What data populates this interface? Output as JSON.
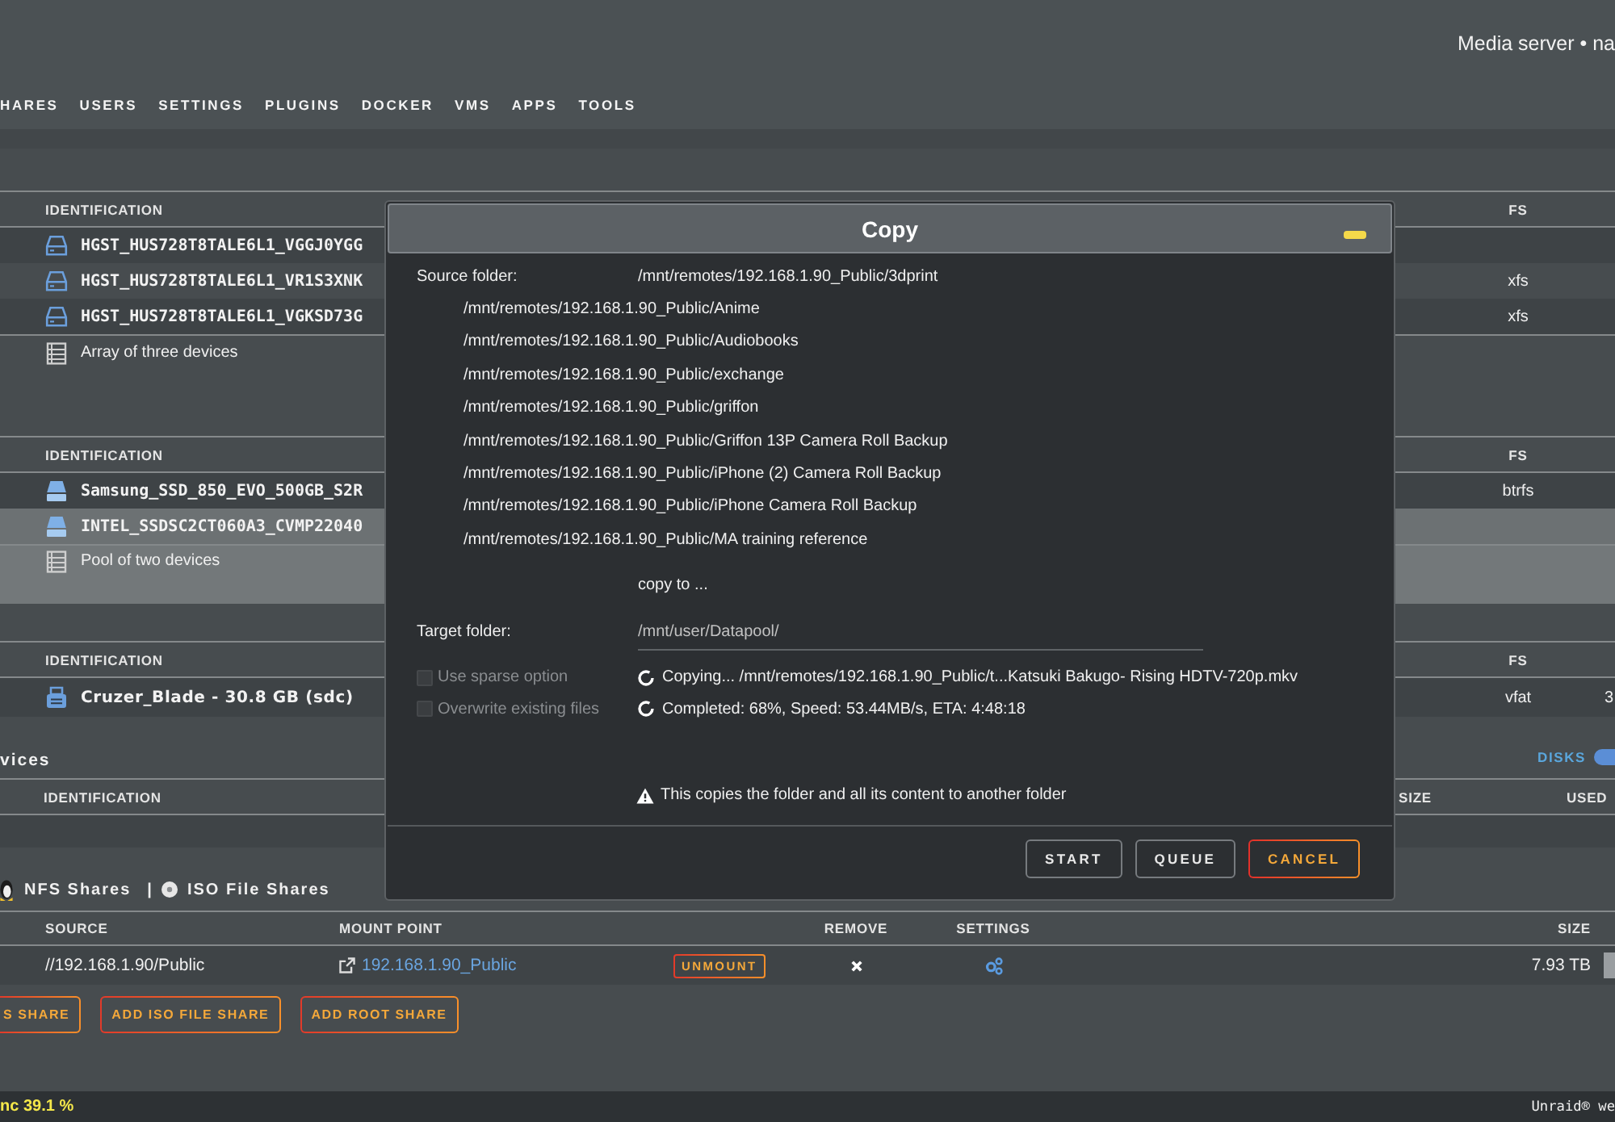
{
  "header": {
    "server_info": "Media server • na",
    "nav": [
      "HARES",
      "USERS",
      "SETTINGS",
      "PLUGINS",
      "DOCKER",
      "VMS",
      "APPS",
      "TOOLS"
    ]
  },
  "disk_tables": [
    {
      "columns": [
        "IDENTIFICATION",
        "FS"
      ],
      "rows": [
        {
          "kind": "hdd",
          "name": "HGST_HUS728T8TALE6L1_VGGJ0YGG"
        },
        {
          "kind": "hdd",
          "name": "HGST_HUS728T8TALE6L1_VR1S3XNK",
          "fs": "xfs"
        },
        {
          "kind": "hdd",
          "name": "HGST_HUS728T8TALE6L1_VGKSD73G",
          "fs": "xfs"
        },
        {
          "kind": "summary",
          "name": "Array of three devices"
        }
      ]
    },
    {
      "columns": [
        "IDENTIFICATION",
        "FS"
      ],
      "rows": [
        {
          "kind": "ssd",
          "name": "Samsung_SSD_850_EVO_500GB_S2R",
          "fs": "btrfs",
          "highlighted": false
        },
        {
          "kind": "ssd",
          "name": "INTEL_SSDSC2CT060A3_CVMP22040",
          "highlighted": true
        },
        {
          "kind": "summary",
          "name": "Pool of two devices",
          "highlighted": true
        }
      ]
    },
    {
      "columns": [
        "IDENTIFICATION",
        "FS"
      ],
      "rows": [
        {
          "kind": "usb",
          "name": "Cruzer_Blade - 30.8 GB (sdc)",
          "fs": "vfat",
          "column_3": "3"
        }
      ]
    }
  ],
  "unassigned": {
    "heading": "vices",
    "toggle": {
      "label": "DISKS",
      "on": true
    },
    "columns": [
      "IDENTIFICATION",
      "SIZE",
      "USED"
    ]
  },
  "remote_shares": {
    "sections": [
      {
        "kind": "nfs",
        "label": "NFS Shares"
      },
      {
        "kind": "iso",
        "label": "ISO File Shares"
      }
    ],
    "separator": "|",
    "columns": [
      "SOURCE",
      "MOUNT POINT",
      "REMOVE",
      "SETTINGS",
      "SIZE"
    ],
    "rows": [
      {
        "source": "//192.168.1.90/Public",
        "mount_point": "192.168.1.90_Public",
        "action": "UNMOUNT",
        "size": "7.93 TB"
      }
    ],
    "buttons": [
      "S SHARE",
      "ADD ISO FILE SHARE",
      "ADD ROOT SHARE"
    ]
  },
  "dialog": {
    "title": "Copy",
    "source_label": "Source folder:",
    "source": "/mnt/remotes/192.168.1.90_Public/3dprint",
    "more_sources": [
      "/mnt/remotes/192.168.1.90_Public/Anime",
      "/mnt/remotes/192.168.1.90_Public/Audiobooks",
      "/mnt/remotes/192.168.1.90_Public/exchange",
      "/mnt/remotes/192.168.1.90_Public/griffon",
      "/mnt/remotes/192.168.1.90_Public/Griffon 13P Camera Roll Backup",
      "/mnt/remotes/192.168.1.90_Public/iPhone (2) Camera Roll Backup",
      "/mnt/remotes/192.168.1.90_Public/iPhone Camera Roll Backup",
      "/mnt/remotes/192.168.1.90_Public/MA training reference"
    ],
    "copy_to": "copy to ...",
    "target_label": "Target folder:",
    "target": "/mnt/user/Datapool/",
    "options": [
      {
        "label": "Use sparse option",
        "checked": false,
        "disabled": true
      },
      {
        "label": "Overwrite existing files",
        "checked": false,
        "disabled": true
      }
    ],
    "status": [
      "Copying... /mnt/remotes/192.168.1.90_Public/t...Katsuki Bakugo- Rising HDTV-720p.mkv",
      "Completed: 68%, Speed: 53.44MB/s, ETA: 4:48:18"
    ],
    "note": "This copies the folder and all its content to another folder",
    "buttons": [
      {
        "label": "START",
        "kind": "plain"
      },
      {
        "label": "QUEUE",
        "kind": "plain"
      },
      {
        "label": "CANCEL",
        "kind": "accent"
      }
    ]
  },
  "status_bar": {
    "left": "nc 39.1 %",
    "right": "Unraid® we"
  }
}
